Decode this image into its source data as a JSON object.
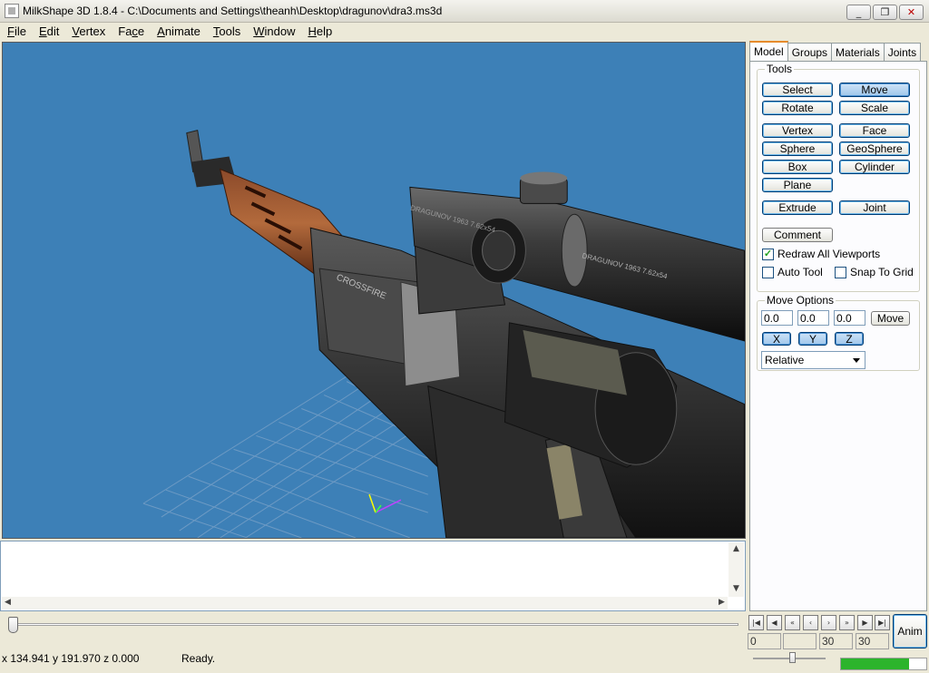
{
  "window": {
    "title": "MilkShape 3D 1.8.4 - C:\\Documents and Settings\\theanh\\Desktop\\dragunov\\dra3.ms3d"
  },
  "menu": [
    {
      "pre": "",
      "u": "F",
      "post": "ile"
    },
    {
      "pre": "",
      "u": "E",
      "post": "dit"
    },
    {
      "pre": "",
      "u": "V",
      "post": "ertex"
    },
    {
      "pre": "Fa",
      "u": "c",
      "post": "e"
    },
    {
      "pre": "",
      "u": "A",
      "post": "nimate"
    },
    {
      "pre": "",
      "u": "T",
      "post": "ools"
    },
    {
      "pre": "",
      "u": "W",
      "post": "indow"
    },
    {
      "pre": "",
      "u": "H",
      "post": "elp"
    }
  ],
  "tabs": [
    "Model",
    "Groups",
    "Materials",
    "Joints"
  ],
  "tools": {
    "label": "Tools",
    "select": "Select",
    "move": "Move",
    "rotate": "Rotate",
    "scale": "Scale",
    "vertex": "Vertex",
    "face": "Face",
    "sphere": "Sphere",
    "geosphere": "GeoSphere",
    "box": "Box",
    "cylinder": "Cylinder",
    "plane": "Plane",
    "extrude": "Extrude",
    "joint": "Joint",
    "comment": "Comment",
    "redraw": "Redraw All Viewports",
    "autotool": "Auto Tool",
    "snap": "Snap To Grid",
    "redraw_checked": true,
    "autotool_checked": false,
    "snap_checked": false
  },
  "move_options": {
    "label": "Move Options",
    "x": "0.0",
    "y": "0.0",
    "z": "0.0",
    "move_button": "Move",
    "x_btn": "X",
    "y_btn": "Y",
    "z_btn": "Z",
    "mode": "Relative"
  },
  "viewport": {
    "background": "#3d80b7",
    "scope_text_1": "DRAGUNOV 1963 7.62x54",
    "scope_text_2": "DRAGUNOV 1963 7.62x54",
    "receiver_text": "CROSSFIRE"
  },
  "anim": {
    "start": "0",
    "end": "",
    "frames": "30",
    "total": "30",
    "anim_button": "Anim",
    "progress": 0.8
  },
  "status": {
    "coords": "x 134.941 y 191.970 z 0.000",
    "message": "Ready."
  }
}
